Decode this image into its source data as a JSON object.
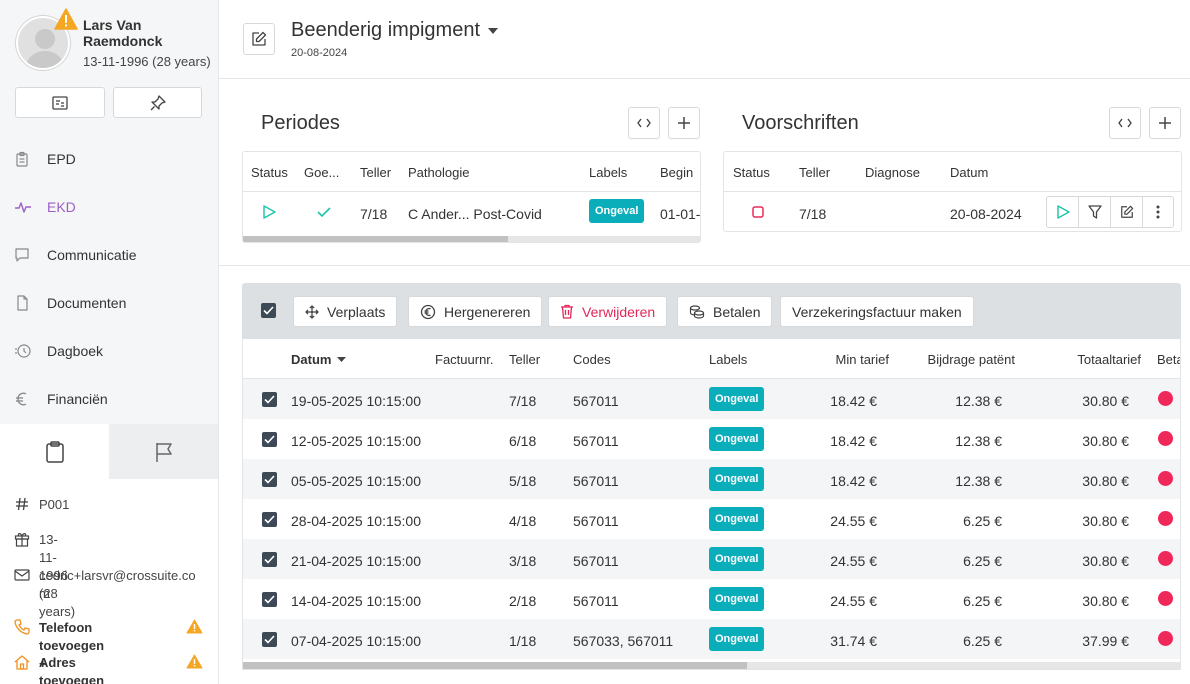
{
  "patient": {
    "name": "Lars Van Raemdonck",
    "dob": "13-11-1996 (28 years)"
  },
  "nav": [
    {
      "label": "EPD",
      "icon": "clipboard-icon"
    },
    {
      "label": "EKD",
      "icon": "pulse-icon",
      "active": true
    },
    {
      "label": "Communicatie",
      "icon": "chat-icon"
    },
    {
      "label": "Documenten",
      "icon": "document-icon"
    },
    {
      "label": "Dagboek",
      "icon": "history-icon"
    },
    {
      "label": "Financiën",
      "icon": "euro-icon"
    }
  ],
  "info": {
    "patient_id": "P001",
    "birthday": "13-11-1996 (28 years)",
    "email_line1": "cedric+larsvr@crossuite.co",
    "email_line2": "m",
    "phone_add": "Telefoon toevoegen +",
    "address_add": "Adres toevoegen +"
  },
  "header": {
    "title": "Beenderig impigment",
    "date": "20-08-2024"
  },
  "periodes": {
    "title": "Periodes",
    "columns": [
      "Status",
      "Goe...",
      "Teller",
      "Pathologie",
      "Labels",
      "Begin"
    ],
    "row": {
      "teller": "7/18",
      "pathologie": "C Ander... Post-Covid",
      "label": "Ongeval",
      "begin": "01-01-"
    }
  },
  "voorschriften": {
    "title": "Voorschriften",
    "columns": [
      "Status",
      "Teller",
      "Diagnose",
      "Datum"
    ],
    "row": {
      "teller": "7/18",
      "datum": "20-08-2024"
    }
  },
  "toolbar": {
    "move": "Verplaats",
    "regenerate": "Hergenereren",
    "delete": "Verwijderen",
    "pay": "Betalen",
    "insurance": "Verzekeringsfactuur maken"
  },
  "table": {
    "columns": {
      "datum": "Datum",
      "factuurnr": "Factuurnr.",
      "teller": "Teller",
      "codes": "Codes",
      "labels": "Labels",
      "min_tarief": "Min tarief",
      "bijdrage": "Bijdrage patënt",
      "totaal": "Totaaltarief",
      "betaald": "Beta"
    },
    "rows": [
      {
        "datum": "19-05-2025 10:15:00",
        "teller": "7/18",
        "codes": "567011",
        "label": "Ongeval",
        "min": "18.42 €",
        "bijdrage": "12.38 €",
        "totaal": "30.80 €"
      },
      {
        "datum": "12-05-2025 10:15:00",
        "teller": "6/18",
        "codes": "567011",
        "label": "Ongeval",
        "min": "18.42 €",
        "bijdrage": "12.38 €",
        "totaal": "30.80 €"
      },
      {
        "datum": "05-05-2025 10:15:00",
        "teller": "5/18",
        "codes": "567011",
        "label": "Ongeval",
        "min": "18.42 €",
        "bijdrage": "12.38 €",
        "totaal": "30.80 €"
      },
      {
        "datum": "28-04-2025 10:15:00",
        "teller": "4/18",
        "codes": "567011",
        "label": "Ongeval",
        "min": "24.55 €",
        "bijdrage": "6.25 €",
        "totaal": "30.80 €"
      },
      {
        "datum": "21-04-2025 10:15:00",
        "teller": "3/18",
        "codes": "567011",
        "label": "Ongeval",
        "min": "24.55 €",
        "bijdrage": "6.25 €",
        "totaal": "30.80 €"
      },
      {
        "datum": "14-04-2025 10:15:00",
        "teller": "2/18",
        "codes": "567011",
        "label": "Ongeval",
        "min": "24.55 €",
        "bijdrage": "6.25 €",
        "totaal": "30.80 €"
      },
      {
        "datum": "07-04-2025 10:15:00",
        "teller": "1/18",
        "codes": "567033, 567011",
        "label": "Ongeval",
        "min": "31.74 €",
        "bijdrage": "6.25 €",
        "totaal": "37.99 €"
      }
    ]
  },
  "colors": {
    "accent_purple": "#9c5fc7",
    "badge_teal": "#0aaebb",
    "danger": "#e32658",
    "warning": "#f5a623",
    "play_green": "#1bc5a8",
    "phone_orange": "#f0901e"
  }
}
